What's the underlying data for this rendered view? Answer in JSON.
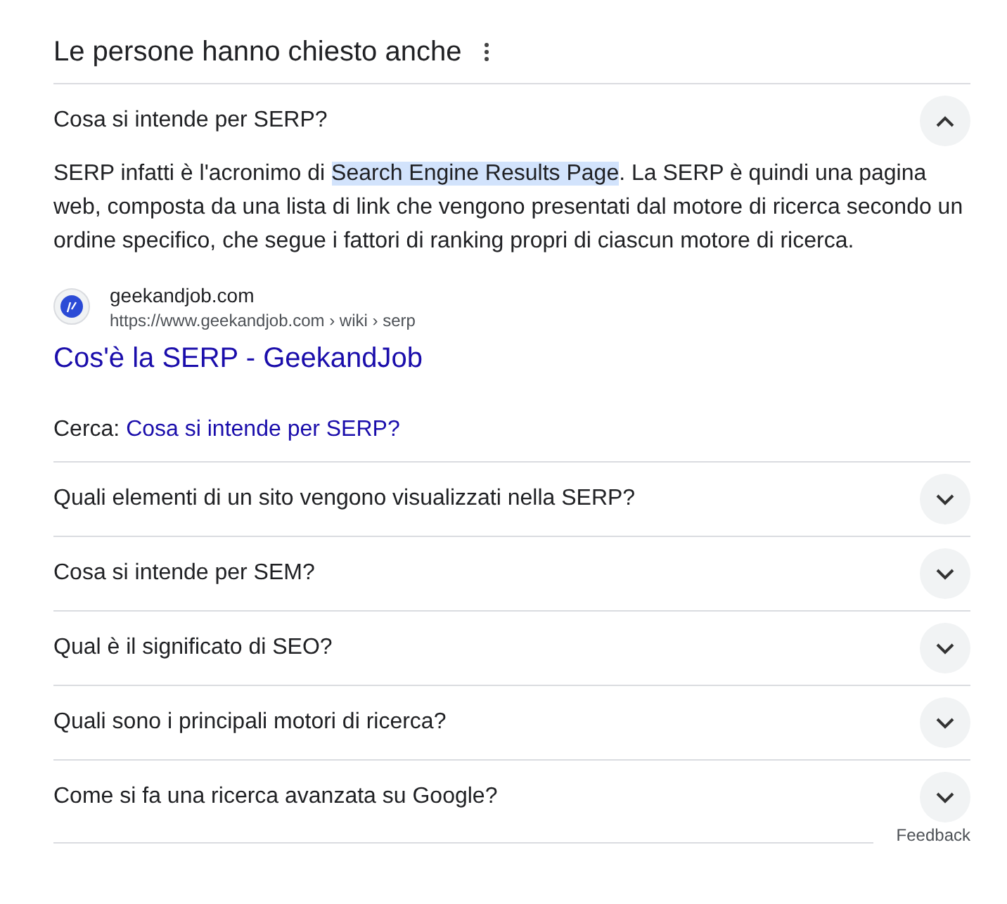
{
  "heading": "Le persone hanno chiesto anche",
  "questions": [
    {
      "question": "Cosa si intende per SERP?",
      "expanded": true,
      "answer": {
        "before": "SERP infatti è l'acronimo di ",
        "highlighted": "Search Engine Results Page",
        "after": ". La SERP è quindi una pagina web, composta da una lista di link che vengono presentati dal motore di ricerca secondo un ordine specifico, che segue i fattori di ranking propri di ciascun motore di ricerca."
      },
      "source": {
        "site": "geekandjob.com",
        "url": "https://www.geekandjob.com › wiki › serp",
        "title": "Cos'è la SERP - GeekandJob"
      },
      "search": {
        "label": "Cerca:",
        "link": "Cosa si intende per SERP?"
      }
    },
    {
      "question": "Quali elementi di un sito vengono visualizzati nella SERP?",
      "expanded": false
    },
    {
      "question": "Cosa si intende per SEM?",
      "expanded": false
    },
    {
      "question": "Qual è il significato di SEO?",
      "expanded": false
    },
    {
      "question": "Quali sono i principali motori di ricerca?",
      "expanded": false
    },
    {
      "question": "Come si fa una ricerca avanzata su Google?",
      "expanded": false
    }
  ],
  "feedback": "Feedback"
}
